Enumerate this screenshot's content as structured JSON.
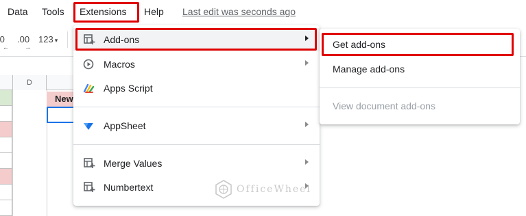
{
  "menubar": {
    "items": [
      {
        "label": "Data"
      },
      {
        "label": "Tools"
      },
      {
        "label": "Extensions"
      },
      {
        "label": "Help"
      }
    ],
    "last_edit": "Last edit was seconds ago"
  },
  "toolbar": {
    "decrease_decimal": ".0",
    "increase_decimal": ".00",
    "more_formats": "123"
  },
  "grid": {
    "column_d": "D",
    "cell_text": "New"
  },
  "extensions_menu": {
    "items": [
      {
        "label": "Add-ons",
        "icon": "addons-icon",
        "has_submenu": true
      },
      {
        "label": "Macros",
        "icon": "macros-icon",
        "has_submenu": true
      },
      {
        "label": "Apps Script",
        "icon": "apps-script-icon",
        "has_submenu": false
      },
      {
        "label": "AppSheet",
        "icon": "appsheet-icon",
        "has_submenu": true
      },
      {
        "label": "Merge Values",
        "icon": "addon-grid-icon",
        "has_submenu": true
      },
      {
        "label": "Numbertext",
        "icon": "addon-grid-icon",
        "has_submenu": true
      }
    ]
  },
  "addons_submenu": {
    "items": [
      {
        "label": "Get add-ons",
        "enabled": true
      },
      {
        "label": "Manage add-ons",
        "enabled": true
      },
      {
        "label": "View document add-ons",
        "enabled": false
      }
    ]
  },
  "watermark": {
    "text": "OfficeWheel"
  },
  "colors": {
    "highlight_box": "#e00000",
    "menu_hover": "#f1f3f4",
    "selection": "#1a73e8",
    "header_cell_fill": "#f4cccc"
  }
}
